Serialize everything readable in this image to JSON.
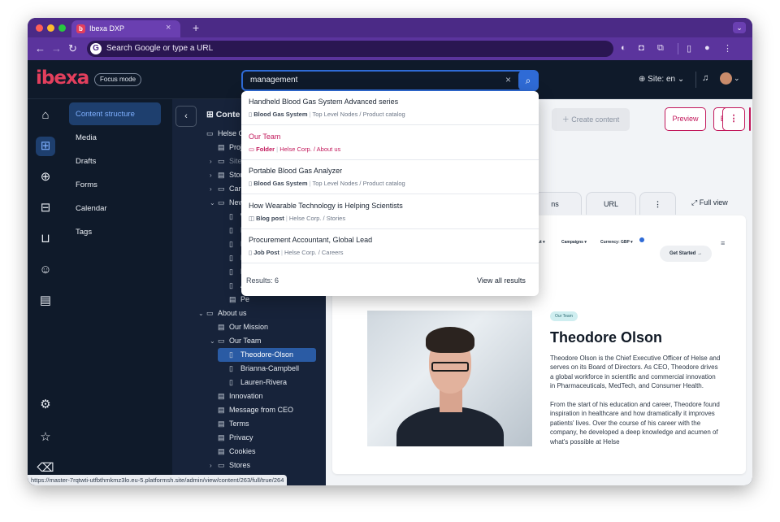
{
  "browser": {
    "tab_title": "Ibexa DXP",
    "tab_favicon": "b",
    "new_tab": "+",
    "omnibox_placeholder": "Search Google or type a URL",
    "status_url": "https://master-7rqtwti-utfbthmkmz3lo.eu-5.platformsh.site/admin/view/content/263/full/true/264",
    "traffic_colors": [
      "#ff5f57",
      "#febc2e",
      "#28c840"
    ]
  },
  "header": {
    "logo": "ibexa",
    "focus_mode": "Focus mode",
    "search_value": "management",
    "site_label": "Site: en"
  },
  "subnav": {
    "items": [
      "Content structure",
      "Media",
      "Drafts",
      "Forms",
      "Calendar",
      "Tags"
    ]
  },
  "tree": {
    "title": "Conte",
    "nodes": [
      {
        "label": "Helse Co",
        "depth": 0,
        "icon": "folder",
        "chev": ""
      },
      {
        "label": "Proje",
        "depth": 1,
        "icon": "doc",
        "chev": ""
      },
      {
        "label": "Site F",
        "depth": 1,
        "icon": "folder",
        "chev": "›",
        "dim": true
      },
      {
        "label": "Storie",
        "depth": 1,
        "icon": "doc",
        "chev": "›"
      },
      {
        "label": "Caree",
        "depth": 1,
        "icon": "folder",
        "chev": "›"
      },
      {
        "label": "News",
        "depth": 1,
        "icon": "folder",
        "chev": "⌄"
      },
      {
        "label": "W",
        "depth": 2,
        "icon": "file",
        "chev": ""
      },
      {
        "label": "H",
        "depth": 2,
        "icon": "file",
        "chev": ""
      },
      {
        "label": "H",
        "depth": 2,
        "icon": "file",
        "chev": ""
      },
      {
        "label": "Pr",
        "depth": 2,
        "icon": "file",
        "chev": ""
      },
      {
        "label": "H",
        "depth": 2,
        "icon": "file",
        "chev": ""
      },
      {
        "label": "A",
        "depth": 2,
        "icon": "file",
        "chev": ""
      },
      {
        "label": "Pe",
        "depth": 2,
        "icon": "doc",
        "chev": ""
      },
      {
        "label": "About us",
        "depth": 0,
        "icon": "folder",
        "chev": "⌄"
      },
      {
        "label": "Our Mission",
        "depth": 1,
        "icon": "doc",
        "chev": ""
      },
      {
        "label": "Our Team",
        "depth": 1,
        "icon": "folder",
        "chev": "⌄"
      },
      {
        "label": "Theodore-Olson",
        "depth": 2,
        "icon": "file",
        "chev": "",
        "selected": true
      },
      {
        "label": "Brianna-Campbell",
        "depth": 2,
        "icon": "file",
        "chev": ""
      },
      {
        "label": "Lauren-Rivera",
        "depth": 2,
        "icon": "file",
        "chev": ""
      },
      {
        "label": "Innovation",
        "depth": 1,
        "icon": "doc",
        "chev": ""
      },
      {
        "label": "Message from CEO",
        "depth": 1,
        "icon": "doc",
        "chev": ""
      },
      {
        "label": "Terms",
        "depth": 1,
        "icon": "doc",
        "chev": ""
      },
      {
        "label": "Privacy",
        "depth": 1,
        "icon": "doc",
        "chev": ""
      },
      {
        "label": "Cookies",
        "depth": 1,
        "icon": "doc",
        "chev": ""
      },
      {
        "label": "Stores",
        "depth": 1,
        "icon": "folder",
        "chev": "›"
      },
      {
        "label": "Campaigns",
        "depth": 0,
        "icon": "folder",
        "chev": ""
      }
    ]
  },
  "content": {
    "create_label": "Create content",
    "preview_label": "Preview",
    "edit_label": "Edit",
    "more_label": "⋮",
    "tab_ns": "ns",
    "tab_url": "URL",
    "tab_more": "⋮",
    "full_view": "Full view"
  },
  "site_preview": {
    "nav": [
      "ut ▾",
      "Campaigns ▾",
      "Currency: GBP ▾"
    ],
    "get_started": "Get Started →",
    "badge": "Our Team",
    "name": "Theodore Olson",
    "bio_1": "Theodore Olson is the Chief Executive Officer of Helse and serves on its Board of Directors. As CEO, Theodore drives a global workforce in scientific and commercial innovation in Pharmaceuticals, MedTech, and Consumer Health.",
    "bio_2": "From the start of his education and career, Theodore found inspiration in healthcare and how dramatically it improves patients' lives. Over the course of his career with the company, he developed a deep knowledge and acumen of what's possible at Helse"
  },
  "dropdown": {
    "items": [
      {
        "title": "Handheld Blood Gas System Advanced series",
        "type": "Blood Gas System",
        "path": "Top Level Nodes / Product catalog",
        "icon": "file"
      },
      {
        "title": "Our Team",
        "type": "Folder",
        "path": "Helse Corp. / About us",
        "icon": "folder",
        "accent": true
      },
      {
        "title": "Portable Blood Gas Analyzer",
        "type": "Blood Gas System",
        "path": "Top Level Nodes / Product catalog",
        "icon": "file"
      },
      {
        "title": "How Wearable Technology is Helping Scientists",
        "type": "Blog post",
        "path": "Helse Corp. / Stories",
        "icon": "blog"
      },
      {
        "title": "Procurement Accountant, Global Lead",
        "type": "Job Post",
        "path": "Helse Corp. / Careers",
        "icon": "file"
      }
    ],
    "results": "Results: 6",
    "view_all": "View all results"
  },
  "icons": {
    "rail": [
      "home-icon",
      "sitemap-icon",
      "globe-icon",
      "product-icon",
      "cart-icon",
      "customer-icon",
      "form-icon",
      "settings-icon",
      "star-icon",
      "trash-icon"
    ]
  },
  "colors": {
    "accent": "#c2185b",
    "brand": "#e33f5d",
    "primary": "#2f6bd6"
  }
}
